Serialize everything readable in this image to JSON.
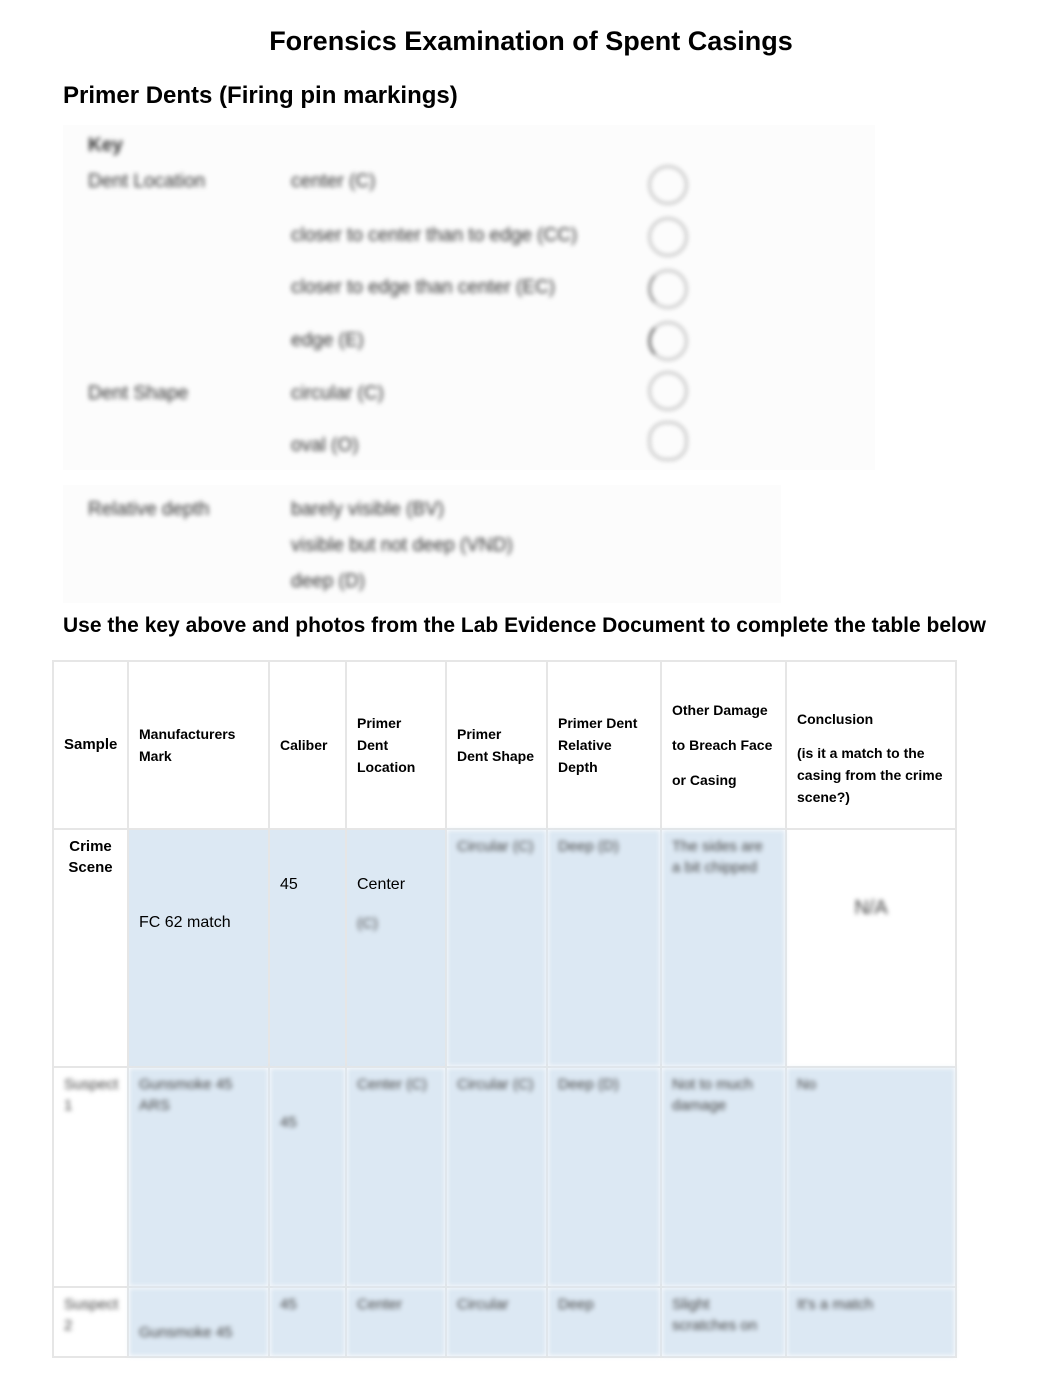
{
  "title": "Forensics Examination of Spent Casings",
  "section": "Primer Dents (Firing pin markings)",
  "key": {
    "heading": "Key",
    "location_label": "Dent Location",
    "locations": [
      "center (C)",
      "closer to center than to edge (CC)",
      "closer to edge than center (EC)",
      "edge (E)"
    ],
    "shape_label": "Dent Shape",
    "shapes": [
      "circular (C)",
      "oval (O)"
    ],
    "depth_label": "Relative depth",
    "depths": [
      "barely visible (BV)",
      "visible but not deep (VND)",
      "deep (D)"
    ]
  },
  "instruction": "Use the key above and photos from the Lab Evidence Document to complete the table below",
  "table": {
    "headers": [
      "Sample",
      "Manufacturers Mark",
      "Caliber",
      "Primer Dent Location",
      "Primer Dent Shape",
      "Primer Dent Relative Depth",
      "Other Damage to Breach Face or Casing",
      "Conclusion",
      "(is it a match to the casing from the crime scene?)"
    ],
    "rows": [
      {
        "sample": "Crime Scene",
        "mark": "FC 62 match",
        "caliber": "45",
        "location": "Center",
        "location_code": "(C)",
        "shape": "Circular (C)",
        "depth": "Deep (D)",
        "damage": "The sides are a bit chipped",
        "conclusion": "N/A"
      },
      {
        "sample": "Suspect 1",
        "mark": "Gunsmoke 45 ARS",
        "caliber": "45",
        "location": "Center (C)",
        "shape": "Circular (C)",
        "depth": "Deep (D)",
        "damage": "Not to much damage",
        "conclusion": "No"
      },
      {
        "sample": "Suspect 2",
        "mark": "Gunsmoke 45",
        "caliber": "45",
        "location": "Center",
        "shape": "Circular",
        "depth": "Deep",
        "damage": "Slight scratches on",
        "conclusion": "It's a match"
      }
    ]
  },
  "colors": {
    "cell_fill": "#dce8f3"
  }
}
